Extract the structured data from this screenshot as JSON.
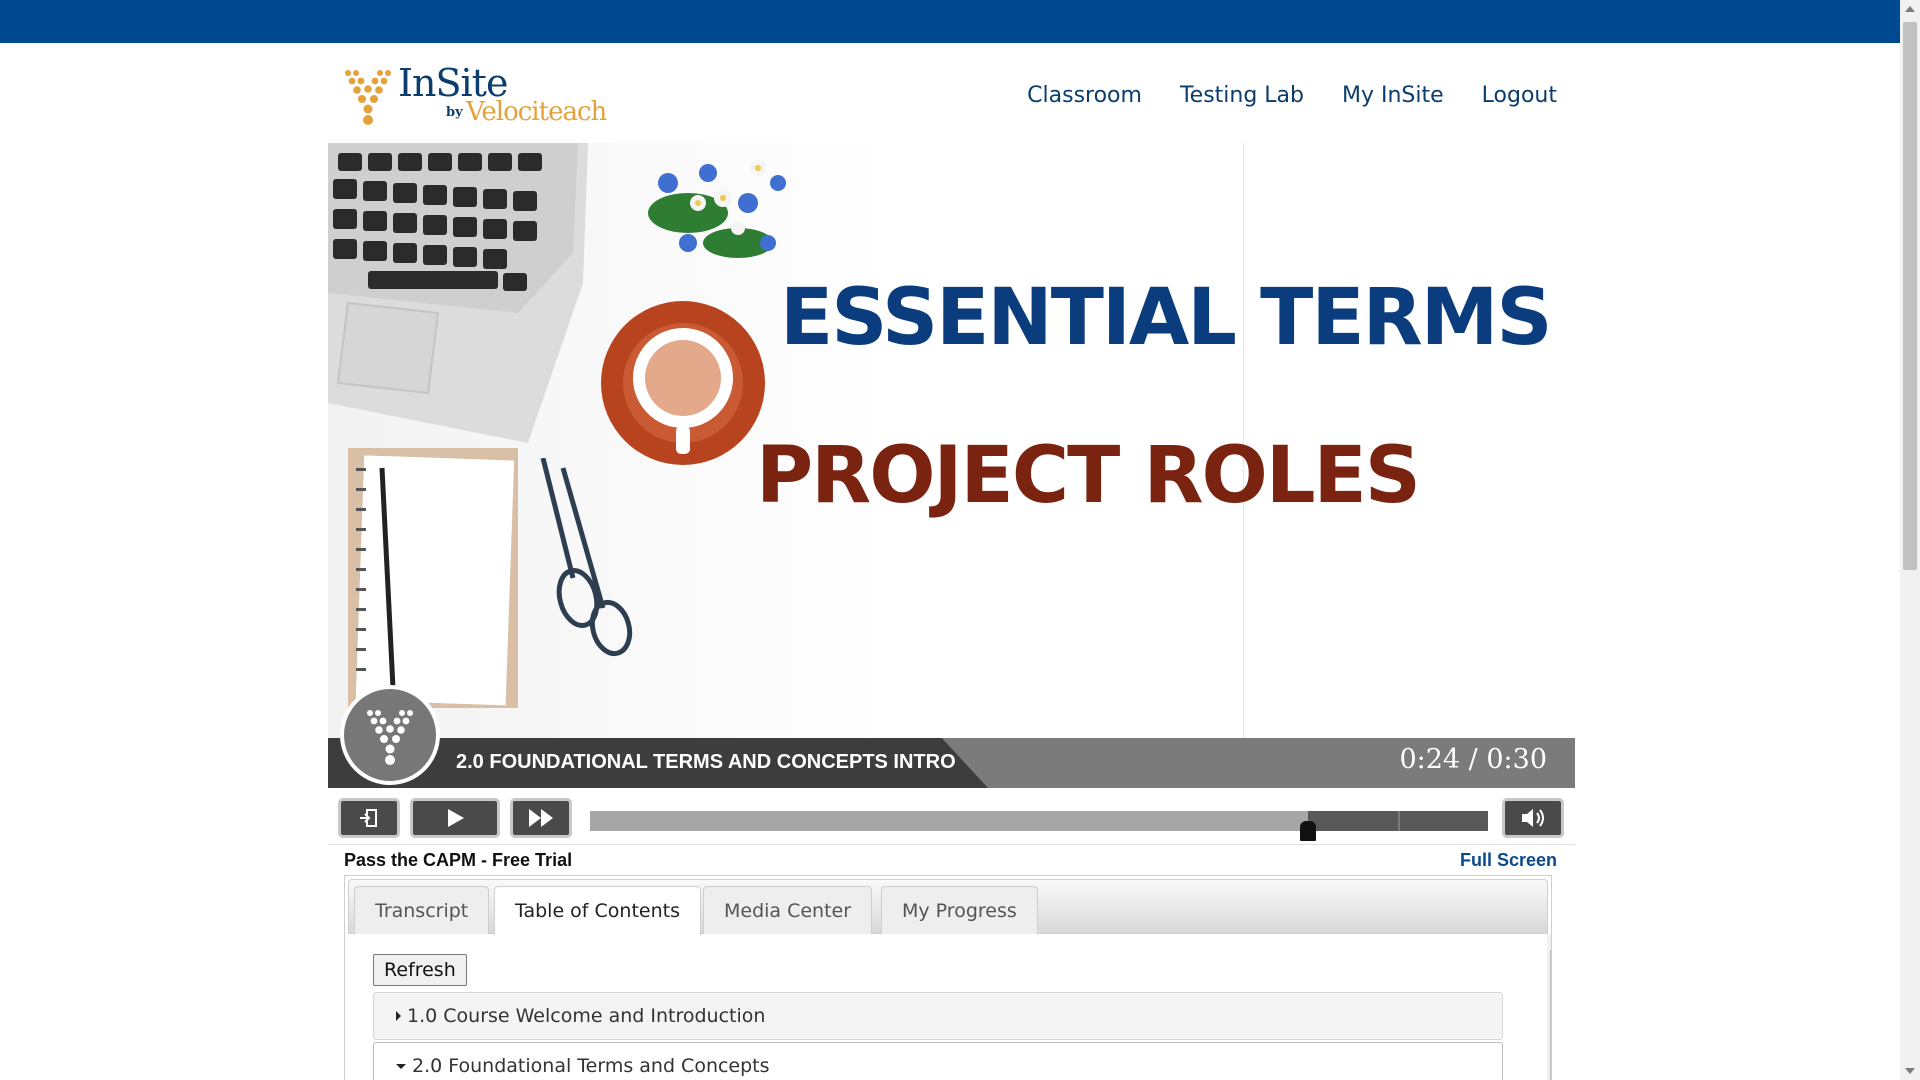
{
  "nav": {
    "items": [
      "Classroom",
      "Testing Lab",
      "My InSite",
      "Logout"
    ]
  },
  "logo": {
    "brand": "InSite",
    "by": "by",
    "sub": "Velociteach"
  },
  "slide": {
    "title_line1": "ESSENTIAL TERMS",
    "title_line2": "PROJECT ROLES",
    "lecture_title": "2.0 FOUNDATIONAL TERMS AND CONCEPTS INTRO",
    "time": "0:24 / 0:30"
  },
  "player": {
    "progress_fraction": 0.8
  },
  "info": {
    "course_name": "Pass the CAPM - Free Trial",
    "full_screen": "Full Screen"
  },
  "tabs": [
    {
      "label": "Transcript"
    },
    {
      "label": "Table of Contents"
    },
    {
      "label": "Media Center"
    },
    {
      "label": "My Progress"
    }
  ],
  "toc": {
    "refresh_label": "Refresh",
    "sections": [
      {
        "label": "1.0 Course Welcome and Introduction"
      },
      {
        "label": "2.0 Foundational Terms and Concepts"
      }
    ]
  },
  "colors": {
    "header_blue": "#004990",
    "brand_navy": "#0b3d6e",
    "brand_gold": "#e6a23a",
    "title_blue": "#0b3d7e",
    "title_red": "#7a2310"
  }
}
